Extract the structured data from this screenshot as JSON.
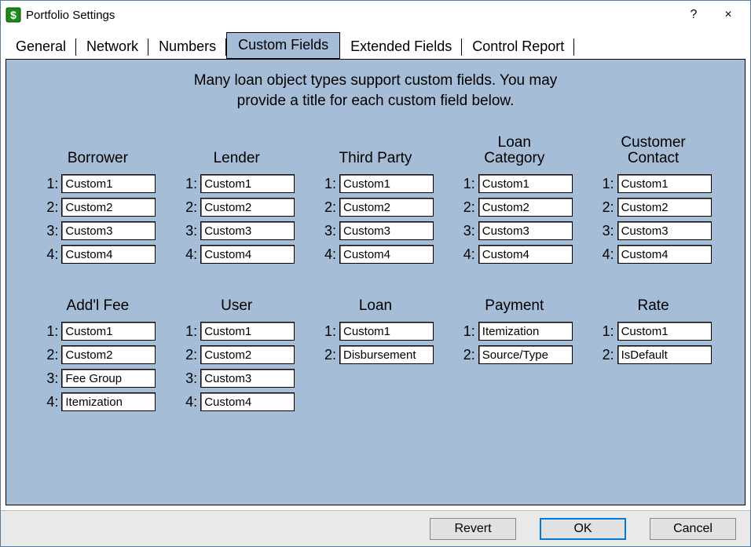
{
  "window": {
    "title": "Portfolio Settings",
    "help_tooltip": "?",
    "close_tooltip": "×"
  },
  "tabs": [
    {
      "label": "General"
    },
    {
      "label": "Network"
    },
    {
      "label": "Numbers"
    },
    {
      "label": "Custom Fields",
      "active": true
    },
    {
      "label": "Extended Fields"
    },
    {
      "label": "Control Report"
    }
  ],
  "intro": {
    "line1": "Many loan object types support custom fields.  You may",
    "line2": "provide a title for each custom field below."
  },
  "field_labels": {
    "1": "1:",
    "2": "2:",
    "3": "3:",
    "4": "4:"
  },
  "groups_top": [
    {
      "title": "Borrower",
      "fields": [
        "Custom1",
        "Custom2",
        "Custom3",
        "Custom4"
      ]
    },
    {
      "title": "Lender",
      "fields": [
        "Custom1",
        "Custom2",
        "Custom3",
        "Custom4"
      ]
    },
    {
      "title": "Third Party",
      "fields": [
        "Custom1",
        "Custom2",
        "Custom3",
        "Custom4"
      ]
    },
    {
      "title": "Loan\nCategory",
      "fields": [
        "Custom1",
        "Custom2",
        "Custom3",
        "Custom4"
      ]
    },
    {
      "title": "Customer\nContact",
      "fields": [
        "Custom1",
        "Custom2",
        "Custom3",
        "Custom4"
      ]
    }
  ],
  "groups_bottom": [
    {
      "title": "Add'l Fee",
      "fields": [
        "Custom1",
        "Custom2",
        "Fee Group",
        "Itemization"
      ]
    },
    {
      "title": "User",
      "fields": [
        "Custom1",
        "Custom2",
        "Custom3",
        "Custom4"
      ]
    },
    {
      "title": "Loan",
      "fields": [
        "Custom1",
        "Disbursement"
      ]
    },
    {
      "title": "Payment",
      "fields": [
        "Itemization",
        "Source/Type"
      ]
    },
    {
      "title": "Rate",
      "fields": [
        "Custom1",
        "IsDefault"
      ]
    }
  ],
  "buttons": {
    "revert": "Revert",
    "ok": "OK",
    "cancel": "Cancel"
  }
}
